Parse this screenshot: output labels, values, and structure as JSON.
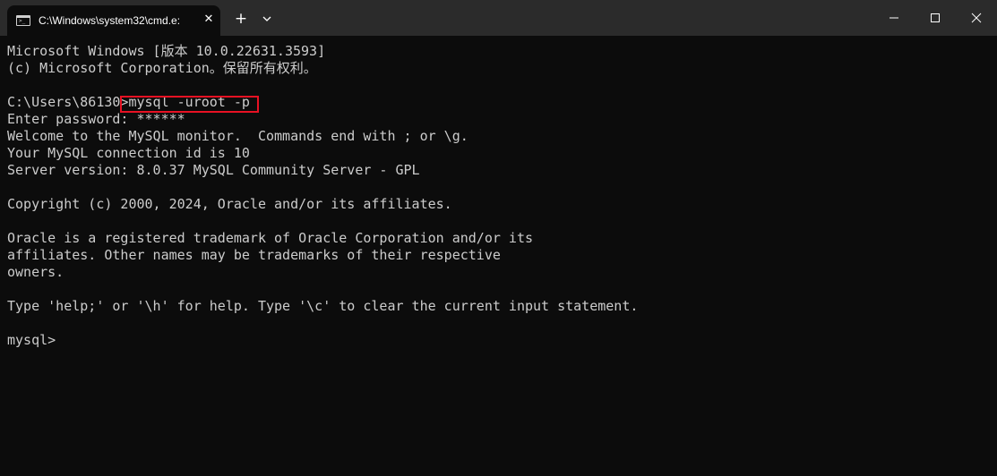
{
  "window": {
    "tab_title": "C:\\Windows\\system32\\cmd.e:",
    "tab_icon": "cmd-icon",
    "close_tab_glyph": "✕",
    "new_tab_glyph": "+",
    "colors": {
      "titlebar": "#2b2b2b",
      "background": "#0c0c0c",
      "text": "#cccccc",
      "highlight": "#e81123"
    }
  },
  "terminal": {
    "lines": [
      "Microsoft Windows [版本 10.0.22631.3593]",
      "(c) Microsoft Corporation。保留所有权利。",
      "",
      "C:\\Users\\86130>mysql -uroot -p",
      "Enter password: ******",
      "Welcome to the MySQL monitor.  Commands end with ; or \\g.",
      "Your MySQL connection id is 10",
      "Server version: 8.0.37 MySQL Community Server - GPL",
      "",
      "Copyright (c) 2000, 2024, Oracle and/or its affiliates.",
      "",
      "Oracle is a registered trademark of Oracle Corporation and/or its",
      "affiliates. Other names may be trademarks of their respective",
      "owners.",
      "",
      "Type 'help;' or '\\h' for help. Type '\\c' to clear the current input statement.",
      "",
      "mysql>"
    ]
  }
}
